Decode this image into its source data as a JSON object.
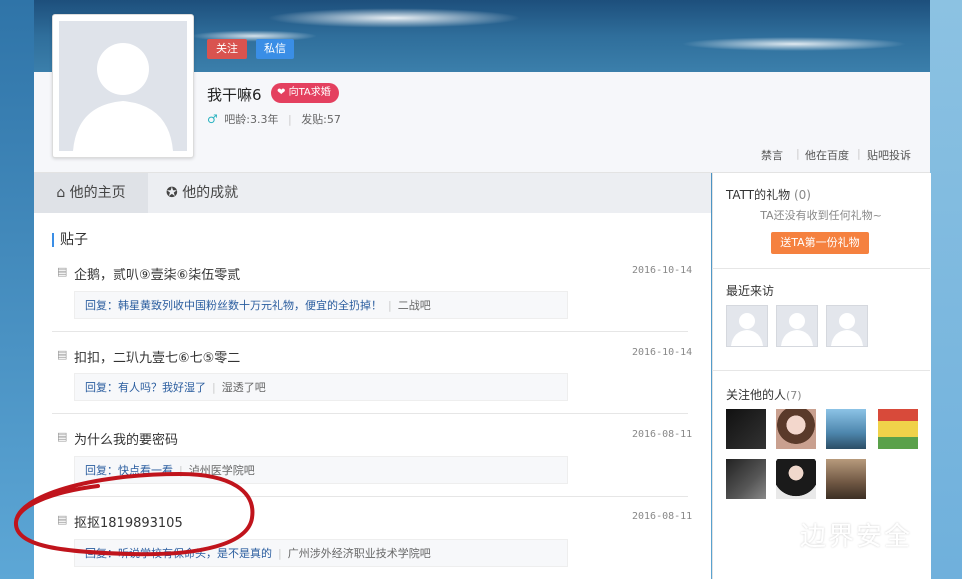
{
  "header": {
    "follow_label": "关注",
    "message_label": "私信",
    "username": "我干嘛6",
    "propose_label": "向TA求婚",
    "bar_age": "吧龄:3.3年",
    "post_count": "发贴:57",
    "links": [
      "禁言",
      "他在百度",
      "贴吧投诉"
    ]
  },
  "tabs": [
    {
      "label": "他的主页",
      "icon": "home-icon"
    },
    {
      "label": "他的成就",
      "icon": "achievement-icon"
    }
  ],
  "posts_section": {
    "title": "贴子",
    "posts": [
      {
        "title": "企鹅，贰叭⑨壹柒⑥柒伍零贰",
        "date": "2016-10-14",
        "reply_prefix": "回复：",
        "reply_text": "韩星黄致列收中国粉丝数十万元礼物，便宜的全扔掉！",
        "bar": "二战吧"
      },
      {
        "title": "扣扣，二玐九壹七⑥七⑤零二",
        "date": "2016-10-14",
        "reply_prefix": "回复：",
        "reply_text": "有人吗？我好湿了",
        "bar": "湿透了吧"
      },
      {
        "title": "为什么我的要密码",
        "date": "2016-08-11",
        "reply_prefix": "回复：",
        "reply_text": "快点看一看",
        "bar": "泸州医学院吧"
      },
      {
        "title": "抠抠1819893105",
        "date": "2016-08-11",
        "reply_prefix": "回复：",
        "reply_text": "听说学校有保命头，是不是真的",
        "bar": "广州涉外经济职业技术学院吧"
      }
    ]
  },
  "sidebar": {
    "gifts_title": "TATT的礼物",
    "gifts_count": "(0)",
    "gifts_empty": "TA还没有收到任何礼物~",
    "gift_button": "送TA第一份礼物",
    "visitors_title": "最近来访",
    "followers_title": "关注他的人",
    "followers_count": "(7)"
  },
  "watermark": "边界安全",
  "colors": {
    "follow": "#d9534f",
    "message": "#3a8ee6",
    "propose": "#e4405f",
    "gift_button": "#f5813f",
    "annotation": "#c0141c"
  }
}
